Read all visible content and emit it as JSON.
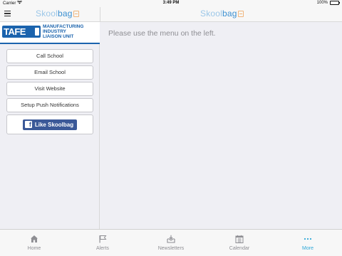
{
  "status_bar": {
    "carrier": "Carrier",
    "time": "3:49 PM",
    "battery": "100%"
  },
  "nav": {
    "logo_left_part1": "Skool",
    "logo_left_part2": "bag",
    "logo_right_part1": "Skool",
    "logo_right_part2": "bag"
  },
  "school": {
    "logo_text": "TAFE",
    "banner_line1": "MANUFACTURING",
    "banner_line2": "INDUSTRY",
    "banner_line3": "LIAISON UNIT"
  },
  "menu": {
    "items": [
      {
        "label": "Call School"
      },
      {
        "label": "Email School"
      },
      {
        "label": "Visit Website"
      },
      {
        "label": "Setup Push Notifications"
      }
    ],
    "facebook_label": "Like Skoolbag"
  },
  "main": {
    "message": "Please use the menu on the left."
  },
  "tabs": [
    {
      "label": "Home",
      "icon": "home-icon"
    },
    {
      "label": "Alerts",
      "icon": "flag-icon"
    },
    {
      "label": "Newsletters",
      "icon": "newsletter-tray-icon"
    },
    {
      "label": "Calendar",
      "icon": "calendar-icon"
    },
    {
      "label": "More",
      "icon": "more-dots-icon",
      "active": true
    }
  ],
  "colors": {
    "accent": "#2fa8d8",
    "school_blue": "#1b63ad",
    "facebook_blue": "#3b5998",
    "background": "#efeff4"
  }
}
